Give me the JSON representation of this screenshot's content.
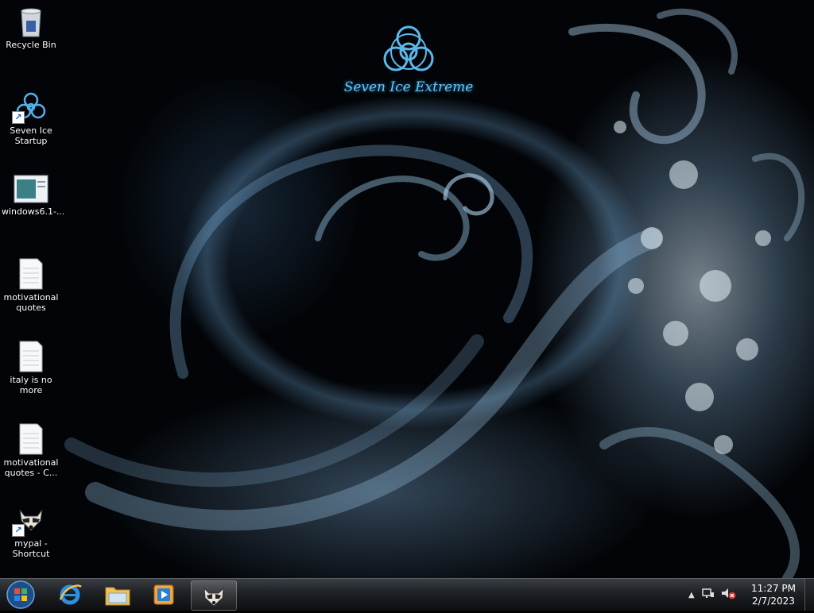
{
  "wallpaper": {
    "logo_text": "Seven Ice Extreme"
  },
  "desktop_icons": [
    {
      "label": "Recycle Bin",
      "icon": "recycle-bin-icon"
    },
    {
      "label": "Seven Ice\nStartup",
      "icon": "biohazard-shortcut-icon"
    },
    {
      "label": "windows6.1-...",
      "icon": "document-window-icon"
    },
    {
      "label": "motivational\nquotes",
      "icon": "text-file-icon"
    },
    {
      "label": "italy is no\nmore",
      "icon": "text-file-icon"
    },
    {
      "label": "motivational\nquotes - C...",
      "icon": "text-file-icon"
    },
    {
      "label": "mypal -\nShortcut",
      "icon": "raccoon-shortcut-icon"
    }
  ],
  "taskbar": {
    "pinned": [
      {
        "name": "start-button",
        "icon": "windows-orb-icon"
      },
      {
        "name": "internet-explorer",
        "icon": "ie-icon"
      },
      {
        "name": "windows-explorer",
        "icon": "folder-icon"
      },
      {
        "name": "media-player",
        "icon": "media-player-icon"
      },
      {
        "name": "mypal",
        "icon": "raccoon-icon",
        "active": true
      }
    ],
    "tray": {
      "time": "11:27 PM",
      "date": "2/7/2023",
      "network_icon": "network-icon",
      "volume_icon": "volume-muted-icon"
    }
  },
  "colors": {
    "accent": "#6fc3f0",
    "taskbar": "#1d2024"
  }
}
